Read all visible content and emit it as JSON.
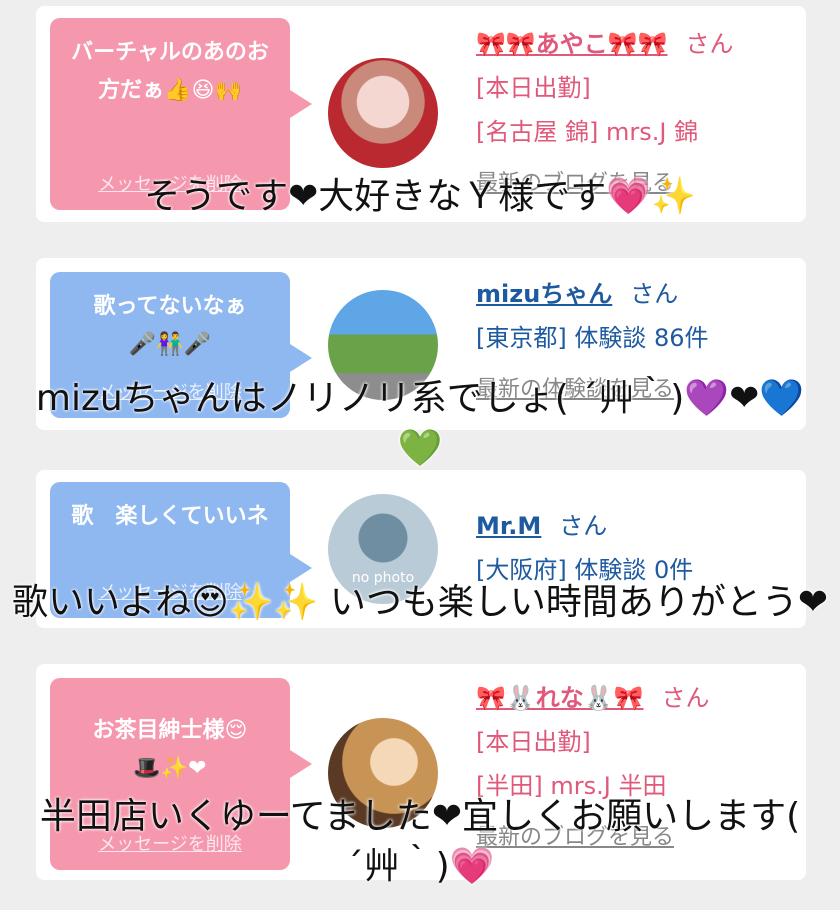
{
  "cards": [
    {
      "bubble": "バーチャルのあのお方だぁ👍😆🙌",
      "delete": "メッセージを削除",
      "name": "🎀🎀あやこ🎀🎀",
      "san": "さん",
      "status": "[本日出勤]",
      "shop": "[名古屋 錦] mrs.J 錦",
      "link": "最新のブログを見る"
    },
    {
      "bubble": "歌ってないなぁ🎤👫🎤",
      "delete": "メッセージを削除",
      "name": "mizuちゃん",
      "san": "さん",
      "area": "[東京都] 体験談 86件",
      "link": "最新の体験談を見る"
    },
    {
      "bubble": "歌　楽しくていいネ",
      "delete": "メッセージを削除",
      "name": "Mr.M",
      "san": "さん",
      "area": "[大阪府] 体験談 0件",
      "avatar_text": "no photo"
    },
    {
      "bubble": "お茶目紳士様😌🎩✨❤",
      "delete": "メッセージを削除",
      "name": "🎀🐰れな🐰🎀",
      "san": "さん",
      "status": "[本日出勤]",
      "shop": "[半田] mrs.J 半田",
      "link": "最新のブログを見る"
    }
  ],
  "captions": [
    "そうです❤大好きなＹ様です💗✨",
    "mizuちゃんはノリノリ系でしょ( ´艸｀)💜❤💙💚",
    "歌いいよね😍✨✨ いつも楽しい時間ありがとう❤",
    "半田店いくゆーてました❤宜しくお願いします( ´艸｀)💗"
  ]
}
